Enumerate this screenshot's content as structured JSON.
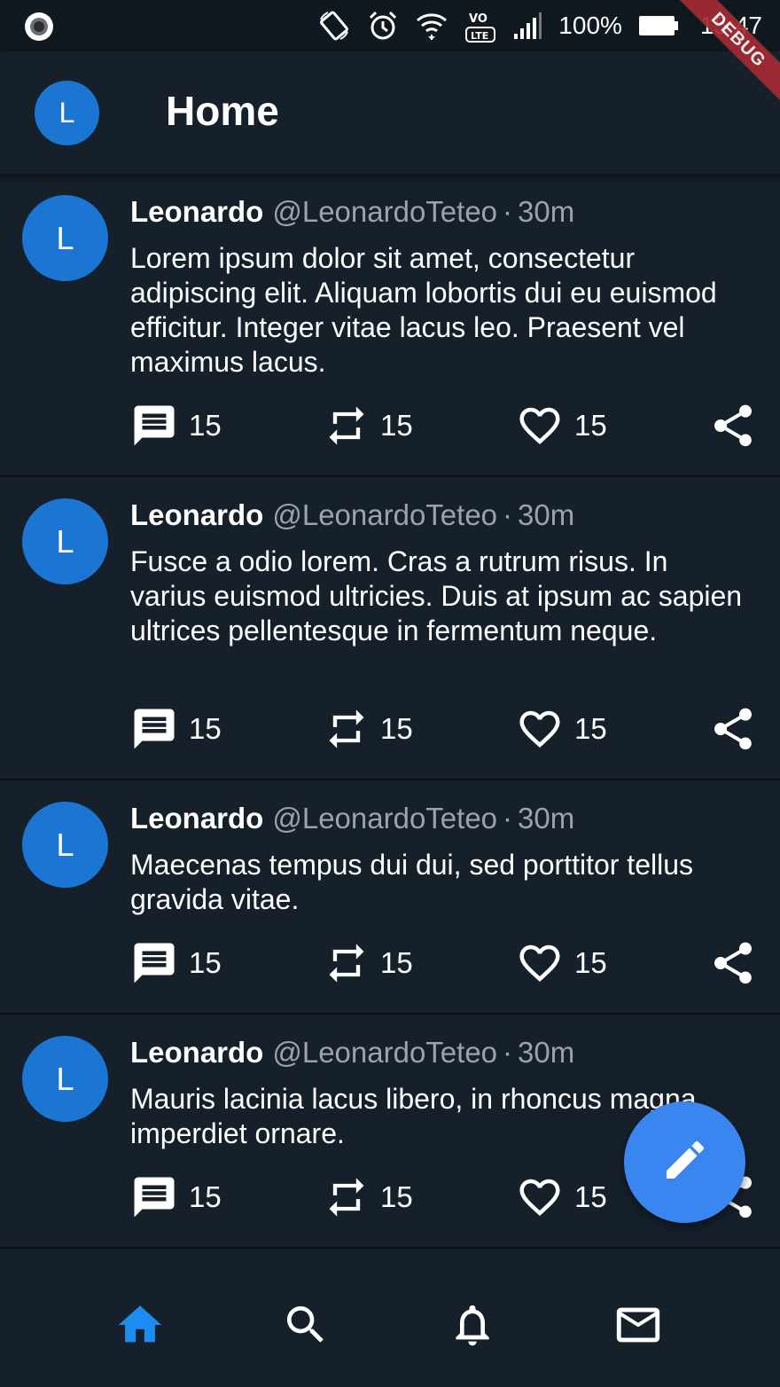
{
  "status_bar": {
    "battery": "100%",
    "time": "15:47",
    "icons": [
      "record-dot-icon",
      "rotate-icon",
      "alarm-icon",
      "wifi-icon",
      "volte-icon",
      "signal-icon",
      "battery-icon"
    ]
  },
  "debug_banner": "DEBUG",
  "app_bar": {
    "avatar_letter": "L",
    "title": "Home"
  },
  "tweets": [
    {
      "avatar_letter": "L",
      "name": "Leonardo",
      "handle": "@LeonardoTeteo",
      "separator": "·",
      "time": "30m",
      "text": "Lorem ipsum dolor sit amet, consectetur adipiscing elit. Aliquam lobortis dui eu euismod efficitur. Integer vitae lacus leo. Praesent vel maximus lacus.",
      "replies": "15",
      "retweets": "15",
      "likes": "15"
    },
    {
      "avatar_letter": "L",
      "name": "Leonardo",
      "handle": "@LeonardoTeteo",
      "separator": "·",
      "time": "30m",
      "text": "Fusce a odio lorem. Cras a rutrum risus. In varius euismod ultricies. Duis at ipsum ac sapien ultrices pellentesque in fermentum neque.",
      "replies": "15",
      "retweets": "15",
      "likes": "15"
    },
    {
      "avatar_letter": "L",
      "name": "Leonardo",
      "handle": "@LeonardoTeteo",
      "separator": "·",
      "time": "30m",
      "text": "Maecenas tempus dui dui, sed porttitor tellus gravida vitae.",
      "replies": "15",
      "retweets": "15",
      "likes": "15"
    },
    {
      "avatar_letter": "L",
      "name": "Leonardo",
      "handle": "@LeonardoTeteo",
      "separator": "·",
      "time": "30m",
      "text": "Mauris lacinia lacus libero, in rhoncus magna imperdiet ornare.",
      "replies": "15",
      "retweets": "15",
      "likes": "15"
    }
  ],
  "fab": {
    "icon": "pencil-icon"
  },
  "bottom_nav": {
    "items": [
      {
        "icon": "home-icon",
        "active": true
      },
      {
        "icon": "search-icon",
        "active": false
      },
      {
        "icon": "bell-icon",
        "active": false
      },
      {
        "icon": "mail-icon",
        "active": false
      }
    ]
  },
  "colors": {
    "background": "#15202b",
    "status_bar": "#101820",
    "avatar": "#1a76d2",
    "fab": "#3a86f0",
    "active_nav": "#1d8cf0",
    "secondary_text": "#9ba3ab"
  }
}
